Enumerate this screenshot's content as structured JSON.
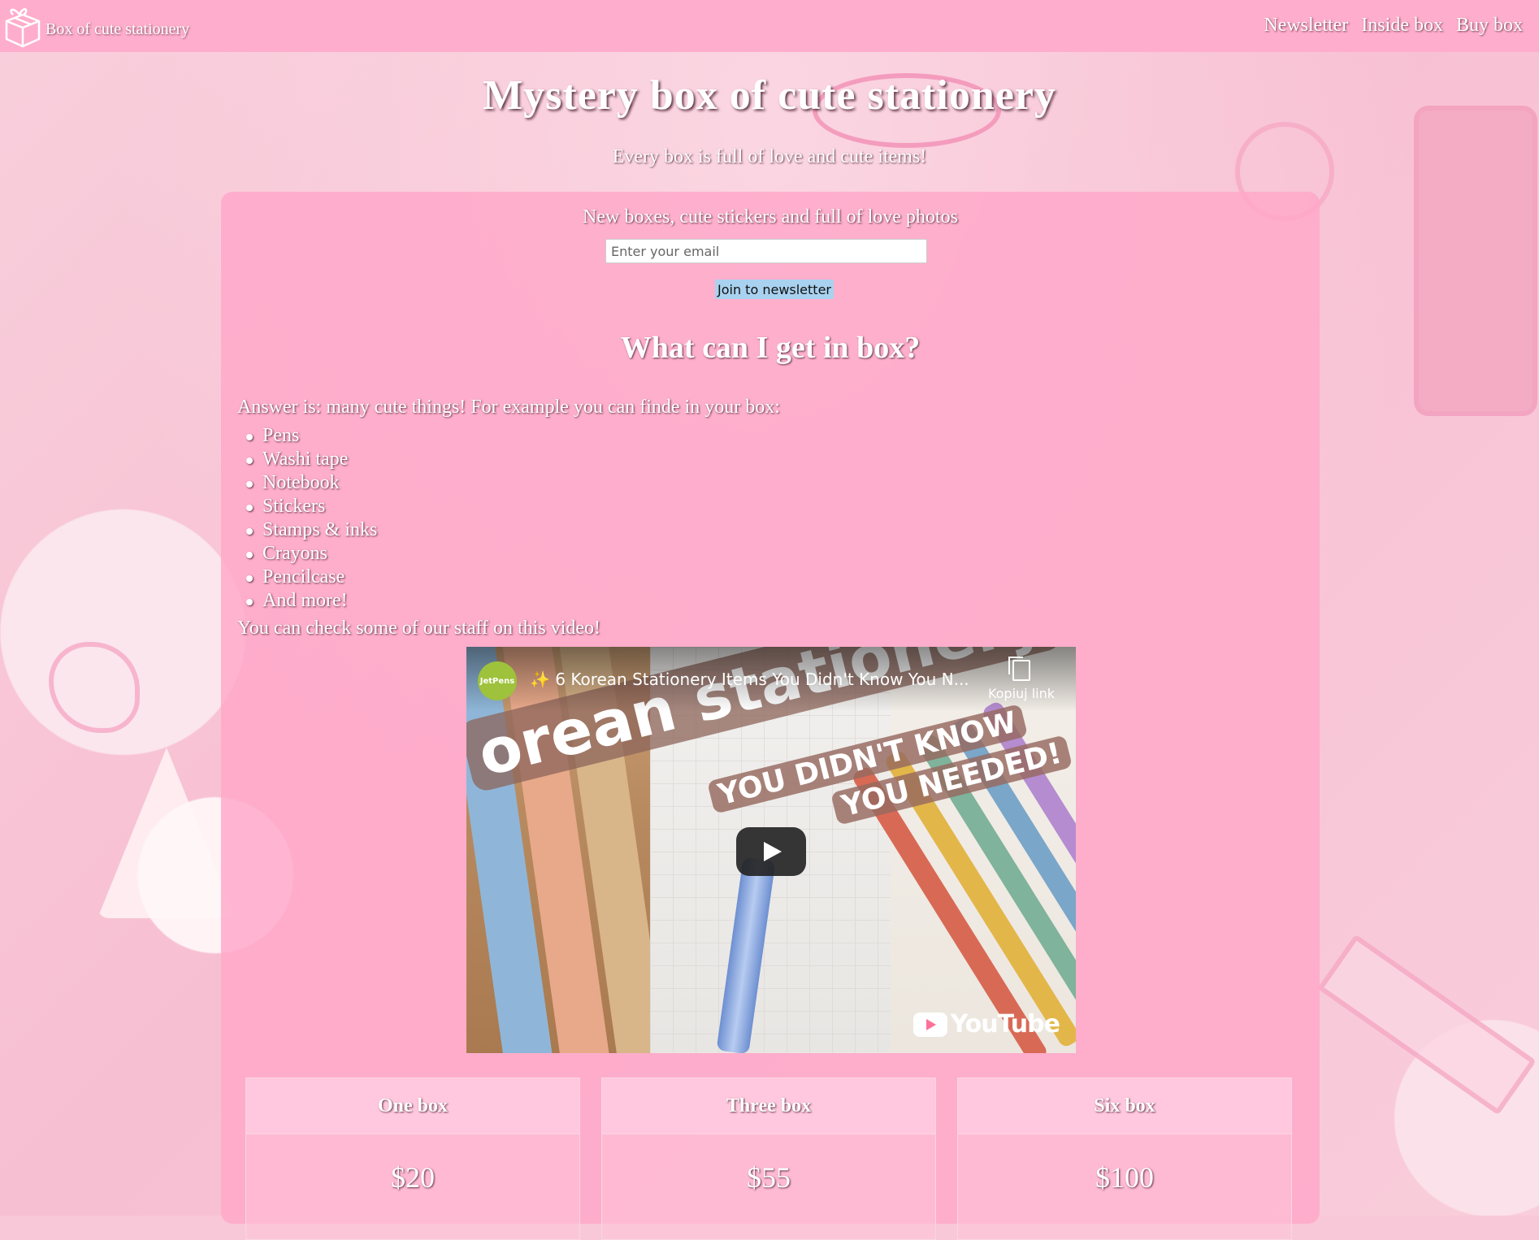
{
  "brand": {
    "name": "Box of cute stationery",
    "icon": "gift-box-icon"
  },
  "nav": [
    {
      "label": "Newsletter"
    },
    {
      "label": "Inside box"
    },
    {
      "label": "Buy box"
    }
  ],
  "hero": {
    "title": "Mystery box of cute stationery",
    "subtitle": "Every box is full of love and cute items!"
  },
  "newsletter": {
    "title": "New boxes, cute stickers and full of love photos",
    "email_placeholder": "Enter your email",
    "button_label": "Join to newsletter"
  },
  "inside": {
    "title": "What can I get in box?",
    "answer": "Answer is: many cute things! For example you can finde in your box:",
    "items": [
      "Pens",
      "Washi tape",
      "Notebook",
      "Stickers",
      "Stamps & inks",
      "Crayons",
      "Pencilcase",
      "And more!"
    ],
    "video_note": "You can check some of our staff on this video!"
  },
  "video": {
    "channel": "JetPens",
    "title": "✨ 6 Korean Stationery Items You Didn't Know You N...",
    "copy_link_label": "Kopiuj link",
    "thumbnail_text": "orean stationery",
    "thumbnail_tag_1": "YOU DIDN'T KNOW",
    "thumbnail_tag_2": "YOU NEEDED!",
    "platform": "YouTube"
  },
  "plans": [
    {
      "name": "One box",
      "price": "$20"
    },
    {
      "name": "Three box",
      "price": "$55"
    },
    {
      "name": "Six box",
      "price": "$100"
    }
  ],
  "colors": {
    "topbar": "#ffadcd",
    "panel": "#ffa7c8",
    "button": "#a9d2f0"
  }
}
